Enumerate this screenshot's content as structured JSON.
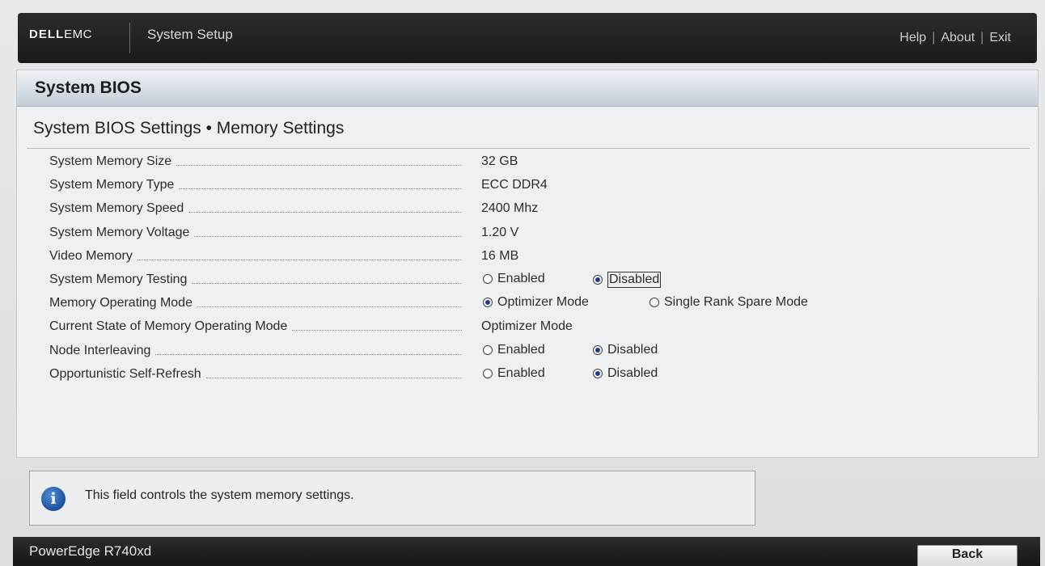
{
  "header": {
    "logo_dell": "DELL",
    "logo_emc": "EMC",
    "app_title": "System Setup",
    "links": [
      "Help",
      "About",
      "Exit"
    ],
    "separator": "|"
  },
  "panel": {
    "title": "System BIOS",
    "subtitle": "System BIOS Settings • Memory Settings"
  },
  "settings": {
    "memory_size": {
      "label": "System Memory Size",
      "value": "32 GB"
    },
    "memory_type": {
      "label": "System Memory Type",
      "value": "ECC DDR4"
    },
    "memory_speed": {
      "label": "System Memory Speed",
      "value": "2400 Mhz"
    },
    "memory_voltage": {
      "label": "System Memory Voltage",
      "value": "1.20 V"
    },
    "video_memory": {
      "label": "Video Memory",
      "value": "16 MB"
    },
    "memory_testing": {
      "label": "System Memory Testing",
      "opt1": "Enabled",
      "opt2": "Disabled",
      "selected": "Disabled"
    },
    "operating_mode": {
      "label": "Memory Operating Mode",
      "opt1": "Optimizer Mode",
      "opt2": "Single Rank Spare Mode",
      "selected": "Optimizer Mode"
    },
    "current_state": {
      "label": "Current State of Memory Operating Mode",
      "value": "Optimizer Mode"
    },
    "node_interleaving": {
      "label": "Node Interleaving",
      "opt1": "Enabled",
      "opt2": "Disabled",
      "selected": "Disabled"
    },
    "self_refresh": {
      "label": "Opportunistic Self-Refresh",
      "opt1": "Enabled",
      "opt2": "Disabled",
      "selected": "Disabled"
    }
  },
  "help": {
    "icon": "info-icon",
    "text": "This field controls the system memory settings."
  },
  "footer": {
    "model": "PowerEdge R740xd",
    "back_label": "Back"
  },
  "colors": {
    "topbar": "#1f2022",
    "panel_bg": "#eef0f1",
    "radio_selected": "#203a8c",
    "info_icon": "#1d4f9e"
  }
}
